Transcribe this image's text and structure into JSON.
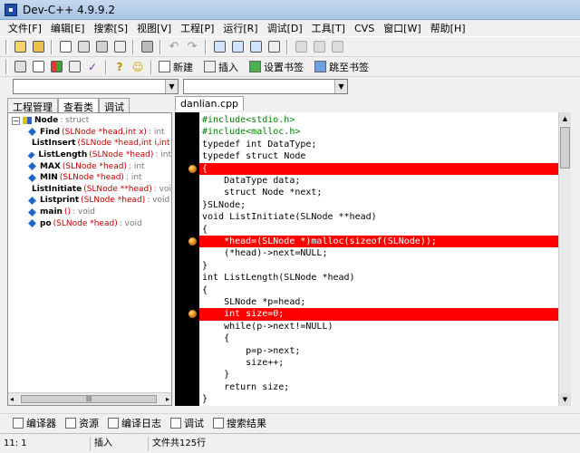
{
  "window": {
    "title": "Dev-C++ 4.9.9.2"
  },
  "menu": [
    "文件[F]",
    "编辑[E]",
    "搜索[S]",
    "视图[V]",
    "工程[P]",
    "运行[R]",
    "调试[D]",
    "工具[T]",
    "CVS",
    "窗口[W]",
    "帮助[H]"
  ],
  "toolbar2": {
    "new_label": "新建",
    "insert_label": "插入",
    "set_bookmark_label": "设置书签",
    "goto_bookmark_label": "跳至书签"
  },
  "left_panel": {
    "tabs": [
      "工程管理",
      "查看类",
      "调试"
    ],
    "tree": {
      "root": {
        "name": "Node",
        "suffix": ": struct"
      },
      "items": [
        {
          "name": "Find",
          "sig": "(SLNode *head,int x)",
          "ret": ": int"
        },
        {
          "name": "ListInsert",
          "sig": "(SLNode *head,int i,int x)",
          "ret": ""
        },
        {
          "name": "ListLength",
          "sig": "(SLNode *head)",
          "ret": ": int"
        },
        {
          "name": "MAX",
          "sig": "(SLNode *head)",
          "ret": ": int"
        },
        {
          "name": "MIN",
          "sig": "(SLNode *head)",
          "ret": ": int"
        },
        {
          "name": "ListInitiate",
          "sig": "(SLNode **head)",
          "ret": ": void"
        },
        {
          "name": "Listprint",
          "sig": "(SLNode *head)",
          "ret": ": void"
        },
        {
          "name": "main",
          "sig": "()",
          "ret": ": void"
        },
        {
          "name": "po",
          "sig": "(SLNode *head)",
          "ret": ": void"
        }
      ]
    }
  },
  "editor": {
    "file_tab": "danlian.cpp",
    "lines": [
      {
        "text": "#include<stdio.h>",
        "kind": "pre"
      },
      {
        "text": "#include<malloc.h>",
        "kind": "pre"
      },
      {
        "text": "typedef int DataType;",
        "kind": ""
      },
      {
        "text": "typedef struct Node",
        "kind": ""
      },
      {
        "text": "{",
        "kind": "hl"
      },
      {
        "text": "    DataType data;",
        "kind": ""
      },
      {
        "text": "    struct Node *next;",
        "kind": ""
      },
      {
        "text": "}SLNode;",
        "kind": ""
      },
      {
        "text": "void ListInitiate(SLNode **head)",
        "kind": ""
      },
      {
        "text": "{",
        "kind": ""
      },
      {
        "text": "    *head=(SLNode *)malloc(sizeof(SLNode));",
        "kind": "hl"
      },
      {
        "text": "    (*head)->next=NULL;",
        "kind": ""
      },
      {
        "text": "}",
        "kind": ""
      },
      {
        "text": "int ListLength(SLNode *head)",
        "kind": ""
      },
      {
        "text": "{",
        "kind": ""
      },
      {
        "text": "    SLNode *p=head;",
        "kind": ""
      },
      {
        "text": "    int size=0;",
        "kind": "hl"
      },
      {
        "text": "    while(p->next!=NULL)",
        "kind": ""
      },
      {
        "text": "    {",
        "kind": ""
      },
      {
        "text": "        p=p->next;",
        "kind": ""
      },
      {
        "text": "        size++;",
        "kind": ""
      },
      {
        "text": "    }",
        "kind": ""
      },
      {
        "text": "    return size;",
        "kind": ""
      },
      {
        "text": "}",
        "kind": ""
      }
    ],
    "highlight_color": "#ff0000"
  },
  "bottom_tabs": [
    "编译器",
    "资源",
    "编译日志",
    "调试",
    "搜索结果"
  ],
  "status": {
    "position": "11: 1",
    "mode": "插入",
    "info": "文件共125行"
  }
}
